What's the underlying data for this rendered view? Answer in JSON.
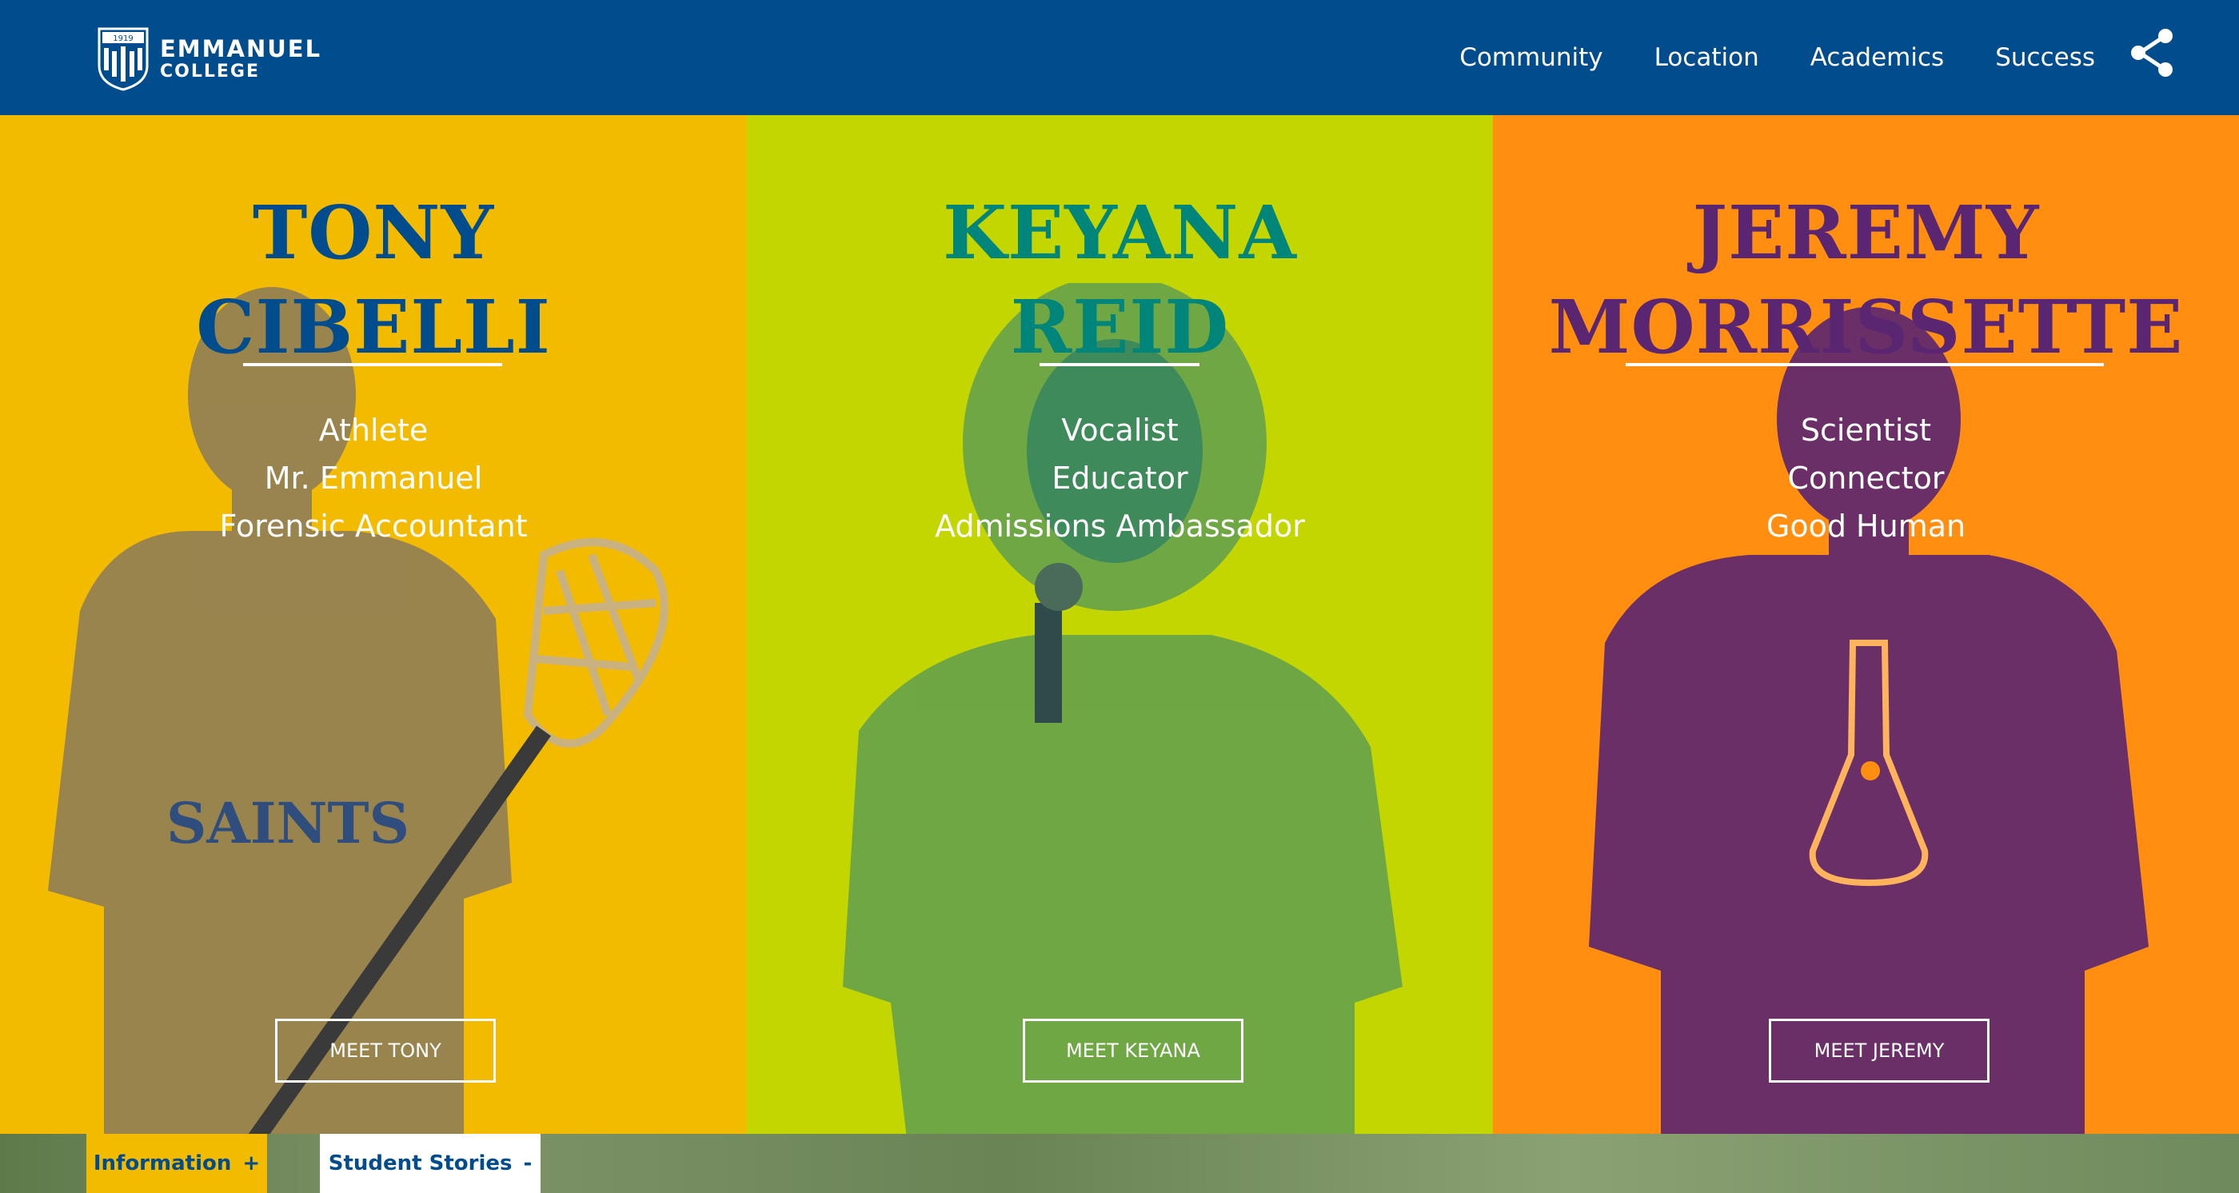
{
  "header": {
    "logo_line1": "EMMANUEL",
    "logo_line2": "COLLEGE",
    "logo_year": "1919",
    "nav": [
      "Community",
      "Location",
      "Academics",
      "Success"
    ],
    "share_icon": "share-icon",
    "bg_color": "#004c8c"
  },
  "students": [
    {
      "first": "TONY",
      "last": "CIBELLI",
      "roles": [
        "Athlete",
        "Mr. Emmanuel",
        "Forensic Accountant"
      ],
      "button": "MEET TONY",
      "bg_color": "#f3bb00",
      "name_color": "#004c8c"
    },
    {
      "first": "KEYANA",
      "last": "REID",
      "roles": [
        "Vocalist",
        "Educator",
        "Admissions Ambassador"
      ],
      "button": "MEET KEYANA",
      "bg_color": "#c3d600",
      "name_color": "#00857a"
    },
    {
      "first": "JEREMY",
      "last": "MORRISSETTE",
      "roles": [
        "Scientist",
        "Connector",
        "Good Human"
      ],
      "button": "MEET JEREMY",
      "bg_color": "#ff8e11",
      "name_color": "#5a2571"
    }
  ],
  "tabs": {
    "information": {
      "label": "Information",
      "toggle": "+"
    },
    "stories": {
      "label": "Student Stories",
      "toggle": "-"
    }
  }
}
